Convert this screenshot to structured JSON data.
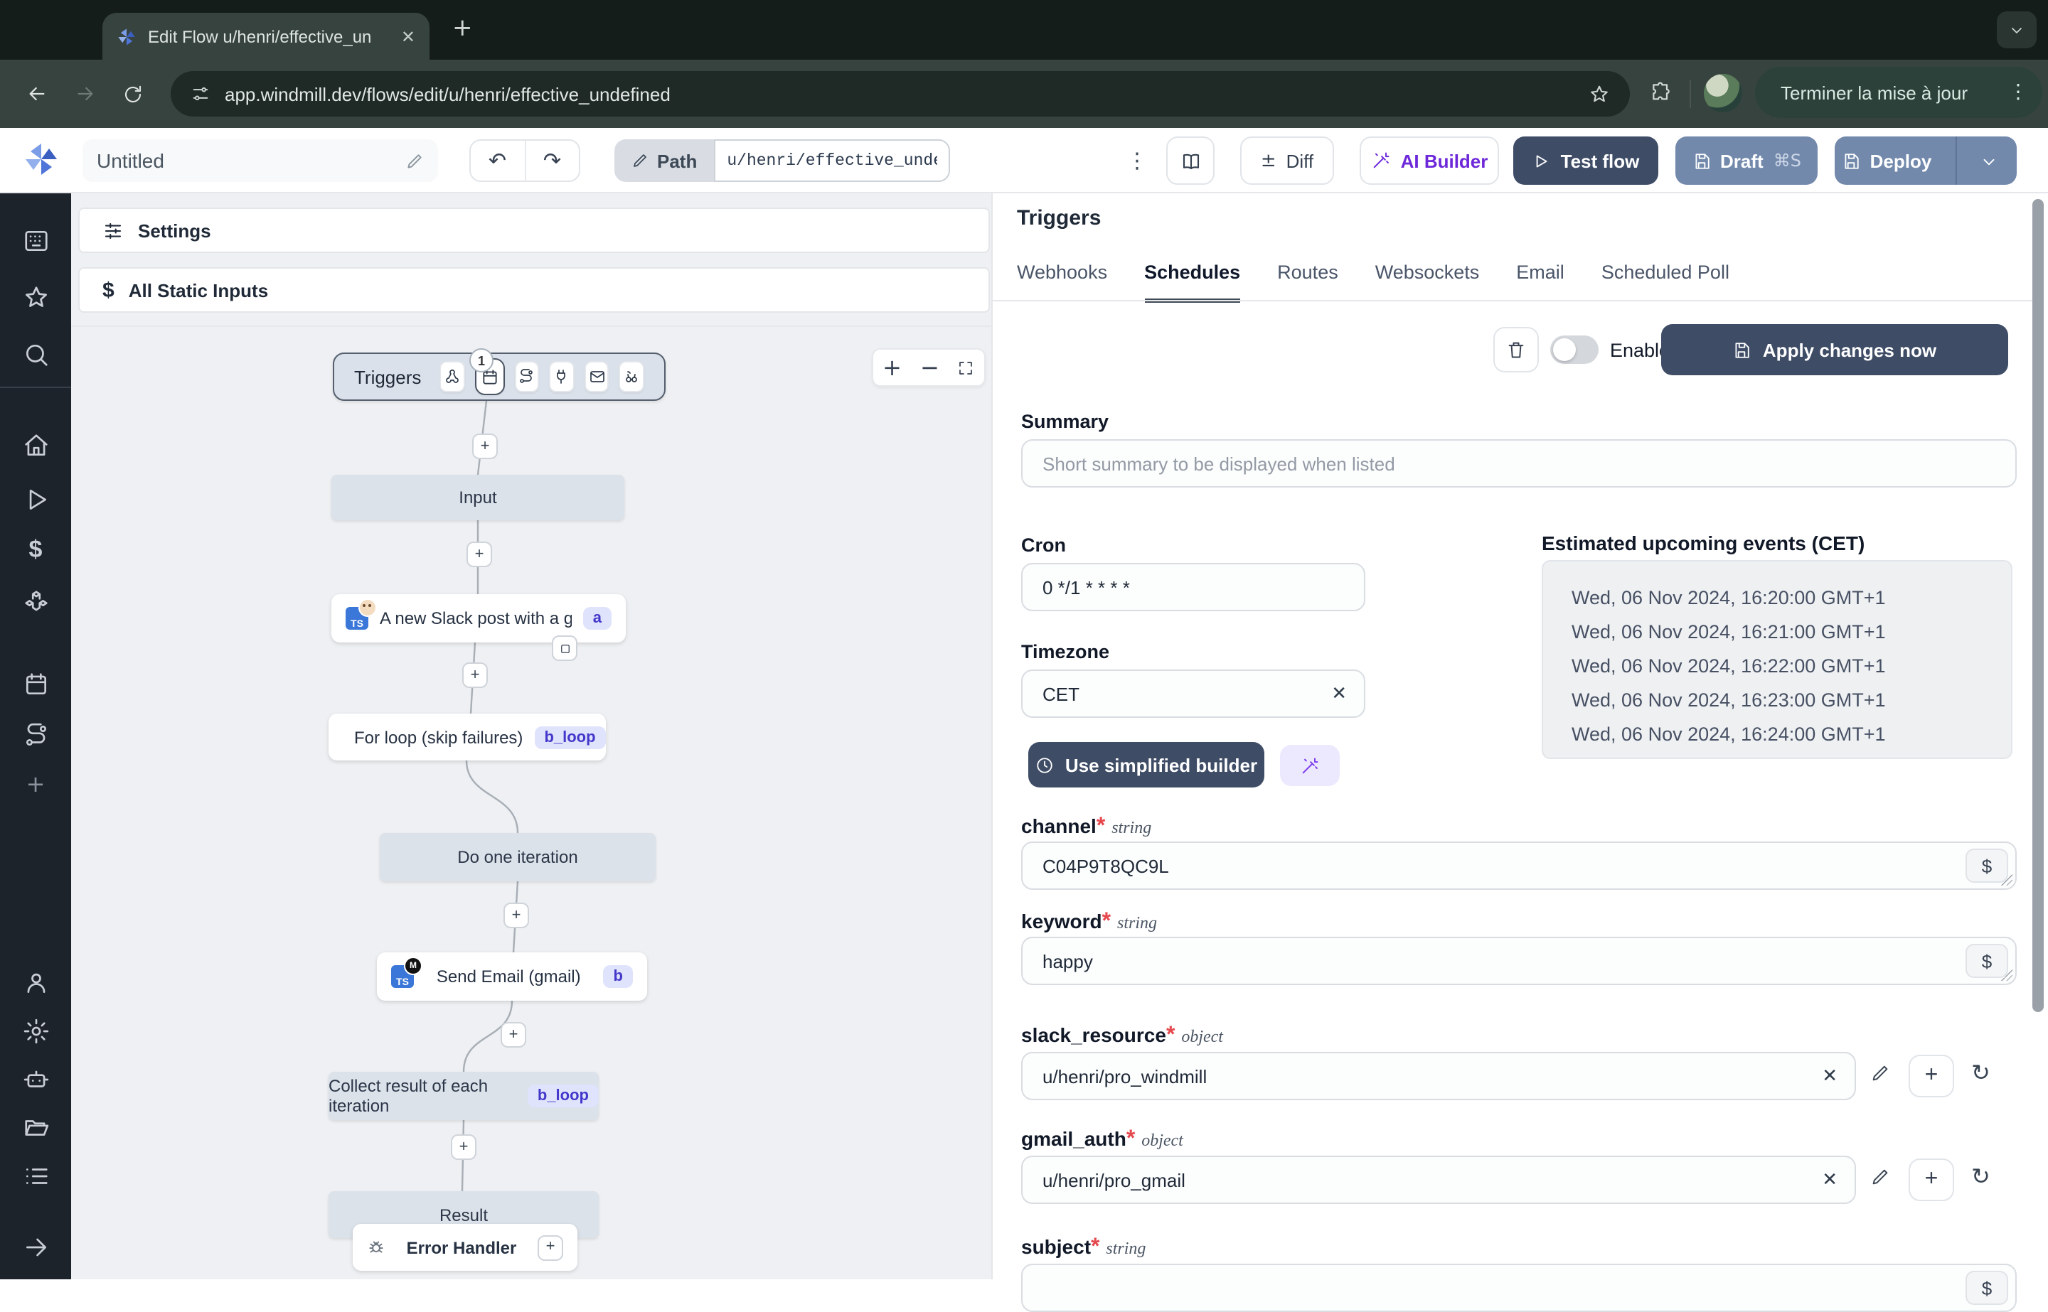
{
  "browser": {
    "tab_title": "Edit Flow u/henri/effective_un",
    "url": "app.windmill.dev/flows/edit/u/henri/effective_undefined",
    "profile_button": "Terminer la mise à jour"
  },
  "header": {
    "flow_name": "Untitled",
    "path_label": "Path",
    "path_value": "u/henri/effective_undef",
    "diff_label": "Diff",
    "ai_builder_label": "AI Builder",
    "test_flow_label": "Test flow",
    "draft_label": "Draft",
    "draft_shortcut": "⌘S",
    "deploy_label": "Deploy"
  },
  "flow_panel": {
    "settings_label": "Settings",
    "static_inputs_label": "All Static Inputs",
    "triggers_label": "Triggers",
    "schedule_count": "1",
    "ts_badge": "TS",
    "input_label": "Input",
    "slack_step_label": "A new Slack post with a given wor...",
    "slack_step_badge": "a",
    "for_loop_label": "For loop (skip failures)",
    "for_loop_badge": "b_loop",
    "iteration_label": "Do one iteration",
    "email_step_label": "Send Email (gmail)",
    "email_step_badge": "b",
    "collect_label": "Collect result of each iteration",
    "collect_badge": "b_loop",
    "result_label": "Result",
    "error_handler_label": "Error Handler"
  },
  "panel": {
    "title": "Triggers",
    "tabs": [
      {
        "label": "Webhooks"
      },
      {
        "label": "Schedules"
      },
      {
        "label": "Routes"
      },
      {
        "label": "Websockets"
      },
      {
        "label": "Email"
      },
      {
        "label": "Scheduled Poll"
      }
    ],
    "active_tab": "Schedules",
    "enabled_label": "Enabled",
    "apply_label": "Apply changes now",
    "summary_label": "Summary",
    "summary_placeholder": "Short summary to be displayed when listed",
    "cron_label": "Cron",
    "cron_value": "0 */1 * * * *",
    "timezone_label": "Timezone",
    "timezone_value": "CET",
    "builder_label": "Use simplified builder",
    "events_title": "Estimated upcoming events (CET)",
    "events": [
      "Wed, 06 Nov 2024, 16:20:00 GMT+1",
      "Wed, 06 Nov 2024, 16:21:00 GMT+1",
      "Wed, 06 Nov 2024, 16:22:00 GMT+1",
      "Wed, 06 Nov 2024, 16:23:00 GMT+1",
      "Wed, 06 Nov 2024, 16:24:00 GMT+1"
    ],
    "dollar_symbol": "$",
    "fields": {
      "channel": {
        "name": "channel",
        "type": "string",
        "value": "C04P9T8QC9L"
      },
      "keyword": {
        "name": "keyword",
        "type": "string",
        "value": "happy"
      },
      "slack_resource": {
        "name": "slack_resource",
        "type": "object",
        "value": "u/henri/pro_windmill"
      },
      "gmail_auth": {
        "name": "gmail_auth",
        "type": "object",
        "value": "u/henri/pro_gmail"
      },
      "subject": {
        "name": "subject",
        "type": "string"
      }
    }
  },
  "icons": {
    "site_info": "tune-sliders",
    "triggers_row": [
      "webhook-icon",
      "calendar-icon",
      "route-icon",
      "plug-icon",
      "mail-icon",
      "scheduled-poll-icon"
    ]
  },
  "colors": {
    "chrome_bg": "#37433f",
    "tabstrip_bg": "#141d1a",
    "url_pill_bg": "#1f2a26",
    "sidebar_bg": "#1d232b",
    "accent_navy": "#3e4c66",
    "accent_slate": "#7289ac",
    "accent_purple": "#6d28d9",
    "badge_bg": "#dfe3fc",
    "badge_text": "#4338ca",
    "required_red": "#e5484d"
  }
}
